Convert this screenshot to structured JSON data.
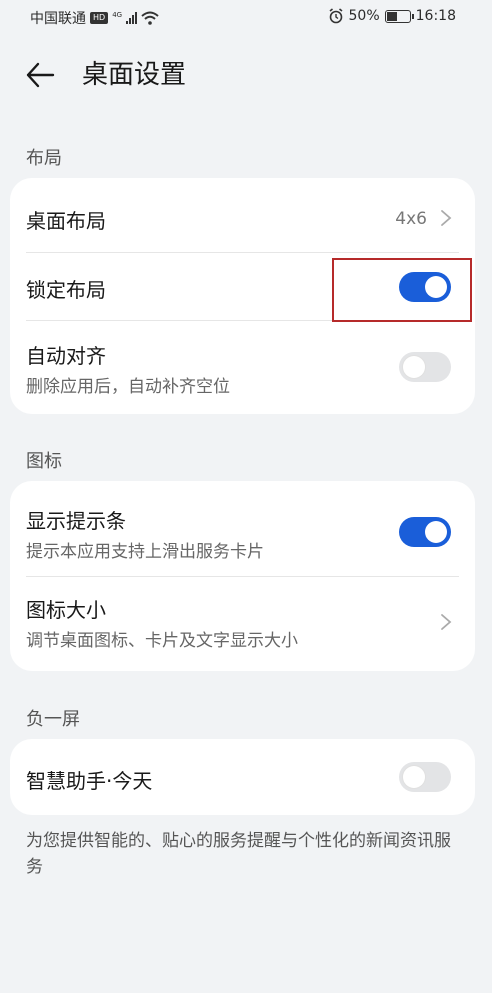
{
  "status_bar": {
    "carrier": "中国联通",
    "hd_badge": "HD",
    "network": "4G",
    "battery": "50%",
    "battery_level": 0.5,
    "time": "16:18"
  },
  "header": {
    "title": "桌面设置"
  },
  "sections": {
    "layout": {
      "label": "布局",
      "desktop_layout": {
        "title": "桌面布局",
        "value": "4x6"
      },
      "lock_layout": {
        "title": "锁定布局",
        "state": "on"
      },
      "auto_align": {
        "title": "自动对齐",
        "subtitle": "删除应用后，自动补齐空位",
        "state": "off"
      }
    },
    "icons": {
      "label": "图标",
      "show_hint_bar": {
        "title": "显示提示条",
        "subtitle": "提示本应用支持上滑出服务卡片",
        "state": "on"
      },
      "icon_size": {
        "title": "图标大小",
        "subtitle": "调节桌面图标、卡片及文字显示大小"
      }
    },
    "minus_one": {
      "label": "负一屏",
      "smart_assistant": {
        "title": "智慧助手·今天",
        "state": "off"
      }
    }
  },
  "footer_note": "为您提供智能的、贴心的服务提醒与个性化的新闻资讯服务",
  "colors": {
    "accent": "#1a5ed9",
    "background": "#f1f3f5",
    "highlight": "#b62a2a"
  }
}
